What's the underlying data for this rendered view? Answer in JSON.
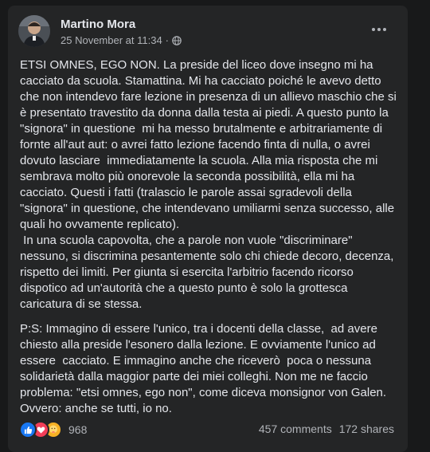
{
  "post": {
    "author": "Martino Mora",
    "timestamp": "25 November at 11:34",
    "separator": "·",
    "privacy_icon": "globe-icon",
    "more_icon": "more-dots-icon",
    "paragraphs": [
      "ETSI OMNES, EGO NON. La preside del liceo dove insegno mi ha cacciato da scuola. Stamattina. Mi ha cacciato poiché le avevo detto che non intendevo fare lezione in presenza di un allievo maschio che si è presentato travestito da donna dalla testa ai piedi. A questo punto la \"signora\" in questione  mi ha messo brutalmente e arbitrariamente di fornte all'aut aut: o avrei fatto lezione facendo finta di nulla, o avrei dovuto lasciare  immediatamente la scuola. Alla mia risposta che mi sembrava molto più onorevole la seconda possibilità, ella mi ha cacciato. Questi i fatti (tralascio le parole assai sgradevoli della \"signora\" in questione, che intendevano umiliarmi senza successo, alle quali ho ovvamente replicato).\n In una scuola capovolta, che a parole non vuole \"discriminare\" nessuno, si discrimina pesantemente solo chi chiede decoro, decenza, rispetto dei limiti. Per giunta si esercita l'arbitrio facendo ricorso dispotico ad un'autorità che a questo punto è solo la grottesca caricatura di se stessa.",
      "P:S: Immagino di essere l'unico, tra i docenti della classe,  ad avere chiesto alla preside l'esonero dalla lezione. E ovviamente l'unico ad essere  cacciato. E immagino anche che riceverò  poca o nessuna solidarietà dalla maggior parte dei miei colleghi. Non me ne faccio problema: \"etsi omnes, ego non\", come diceva monsignor von Galen. Ovvero: anche se tutti, io no."
    ]
  },
  "footer": {
    "reaction_icons": [
      "like-icon",
      "love-icon",
      "care-icon"
    ],
    "reaction_count": "968",
    "comments": "457 comments",
    "shares": "172 shares"
  },
  "colors": {
    "background": "#18191a",
    "card": "#242526",
    "text": "#e4e6eb",
    "secondary_text": "#b0b3b8",
    "like": "#1877f2",
    "love": "#f33e58",
    "care": "#f7b125"
  }
}
